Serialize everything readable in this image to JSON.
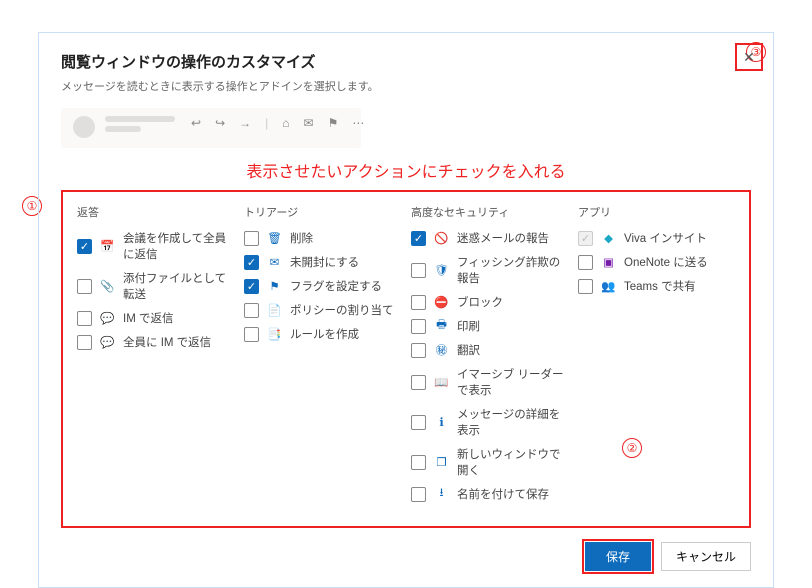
{
  "dialog": {
    "title": "閲覧ウィンドウの操作のカスタマイズ",
    "subtitle": "メッセージを読むときに表示する操作とアドインを選択します。"
  },
  "annotation": "表示させたいアクションにチェックを入れる",
  "callouts": {
    "c1": "①",
    "c2": "②",
    "c3": "③"
  },
  "columns": {
    "reply": {
      "header": "返答",
      "items": [
        {
          "label": "会議を作成して全員に返信",
          "checked": true,
          "icon": "calendar-reply-icon"
        },
        {
          "label": "添付ファイルとして転送",
          "checked": false,
          "icon": "attach-forward-icon"
        },
        {
          "label": "IM で返信",
          "checked": false,
          "icon": "chat-reply-icon"
        },
        {
          "label": "全員に IM で返信",
          "checked": false,
          "icon": "chat-reply-all-icon"
        }
      ]
    },
    "triage": {
      "header": "トリアージ",
      "items": [
        {
          "label": "削除",
          "checked": false,
          "icon": "trash-icon"
        },
        {
          "label": "未開封にする",
          "checked": true,
          "icon": "mail-unread-icon"
        },
        {
          "label": "フラグを設定する",
          "checked": true,
          "icon": "flag-icon"
        },
        {
          "label": "ポリシーの割り当て",
          "checked": false,
          "icon": "policy-icon"
        },
        {
          "label": "ルールを作成",
          "checked": false,
          "icon": "rules-icon"
        }
      ]
    },
    "security": {
      "header": "高度なセキュリティ",
      "items": [
        {
          "label": "迷惑メールの報告",
          "checked": true,
          "icon": "junk-report-icon"
        },
        {
          "label": "フィッシング詐欺の報告",
          "checked": false,
          "icon": "phishing-report-icon"
        },
        {
          "label": "ブロック",
          "checked": false,
          "icon": "block-icon"
        },
        {
          "label": "印刷",
          "checked": false,
          "icon": "print-icon"
        },
        {
          "label": "翻訳",
          "checked": false,
          "icon": "translate-icon"
        },
        {
          "label": "イマーシブ リーダーで表示",
          "checked": false,
          "icon": "immersive-reader-icon"
        },
        {
          "label": "メッセージの詳細を表示",
          "checked": false,
          "icon": "message-details-icon"
        },
        {
          "label": "新しいウィンドウで開く",
          "checked": false,
          "icon": "open-window-icon"
        },
        {
          "label": "名前を付けて保存",
          "checked": false,
          "icon": "save-as-icon"
        }
      ]
    },
    "apps": {
      "header": "アプリ",
      "items": [
        {
          "label": "Viva インサイト",
          "checked": true,
          "disabled": true,
          "icon": "viva-icon",
          "iconClass": "col-viv"
        },
        {
          "label": "OneNote に送る",
          "checked": false,
          "icon": "onenote-icon",
          "iconClass": "col-on"
        },
        {
          "label": "Teams で共有",
          "checked": false,
          "icon": "teams-icon",
          "iconClass": "col-tm"
        }
      ]
    }
  },
  "footer": {
    "save": "保存",
    "cancel": "キャンセル"
  },
  "preview_icons": [
    "↩",
    "↪",
    "→",
    "⋮",
    "⌂",
    "✉",
    "⚑",
    "⋯"
  ]
}
